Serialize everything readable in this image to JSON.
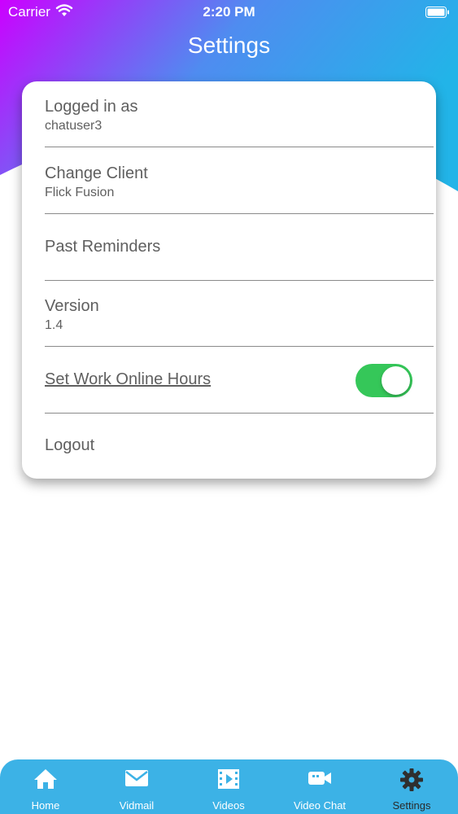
{
  "colors": {
    "gradient_start": "#cc00ff",
    "gradient_end": "#22b4e8",
    "toggle_on": "#35c759",
    "tab_bar": "#3cb2e6",
    "text_gray": "#5f5f5f"
  },
  "status_bar": {
    "carrier": "Carrier",
    "time": "2:20 PM"
  },
  "header": {
    "title": "Settings"
  },
  "settings": {
    "logged_in": {
      "label": "Logged in as",
      "value": "chatuser3"
    },
    "client": {
      "label": "Change Client",
      "value": "Flick Fusion"
    },
    "reminders": {
      "label": "Past Reminders"
    },
    "version": {
      "label": "Version",
      "value": "1.4"
    },
    "work_hours": {
      "label": "Set Work Online Hours",
      "toggle_on": true
    },
    "logout": {
      "label": "Logout"
    }
  },
  "tabs": [
    {
      "label": "Home",
      "icon": "home-icon"
    },
    {
      "label": "Vidmail",
      "icon": "envelope-icon"
    },
    {
      "label": "Videos",
      "icon": "film-icon"
    },
    {
      "label": "Video Chat",
      "icon": "video-camera-icon"
    },
    {
      "label": "Settings",
      "icon": "gear-icon",
      "active": true
    }
  ]
}
